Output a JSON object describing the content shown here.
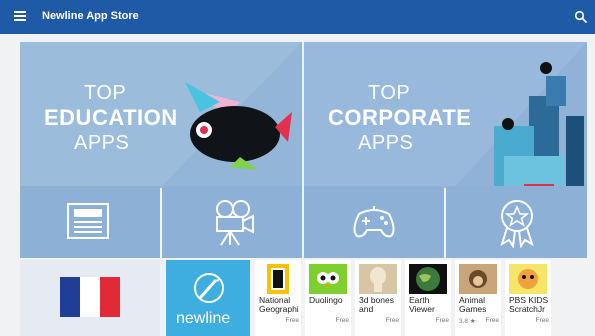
{
  "header": {
    "title": "Newline App Store"
  },
  "banners": [
    {
      "line1": "TOP",
      "line2": "EDUCATION",
      "line3": "APPS"
    },
    {
      "line1": "TOP",
      "line2": "CORPORATE",
      "line3": "APPS"
    }
  ],
  "categories": [
    {
      "icon": "newspaper-icon"
    },
    {
      "icon": "movie-camera-icon"
    },
    {
      "icon": "gamepad-icon"
    },
    {
      "icon": "award-badge-icon"
    }
  ],
  "featured": {
    "flag_icon": "france-flag-icon",
    "newline_label": "newline"
  },
  "apps": [
    {
      "name": "National Geographi",
      "price": "Free",
      "rating": ""
    },
    {
      "name": "Duolingo",
      "price": "Free",
      "rating": ""
    },
    {
      "name": "3d bones and",
      "price": "Free",
      "rating": ""
    },
    {
      "name": "Earth Viewer",
      "price": "Free",
      "rating": ""
    },
    {
      "name": "Animal Games",
      "price": "Free",
      "rating": "3.8 ★"
    },
    {
      "name": "PBS KIDS ScratchJr",
      "price": "Free",
      "rating": ""
    }
  ],
  "colors": {
    "topbar": "#1f5aa7",
    "tile": "#8cb0d6",
    "newline": "#3eaee0"
  }
}
